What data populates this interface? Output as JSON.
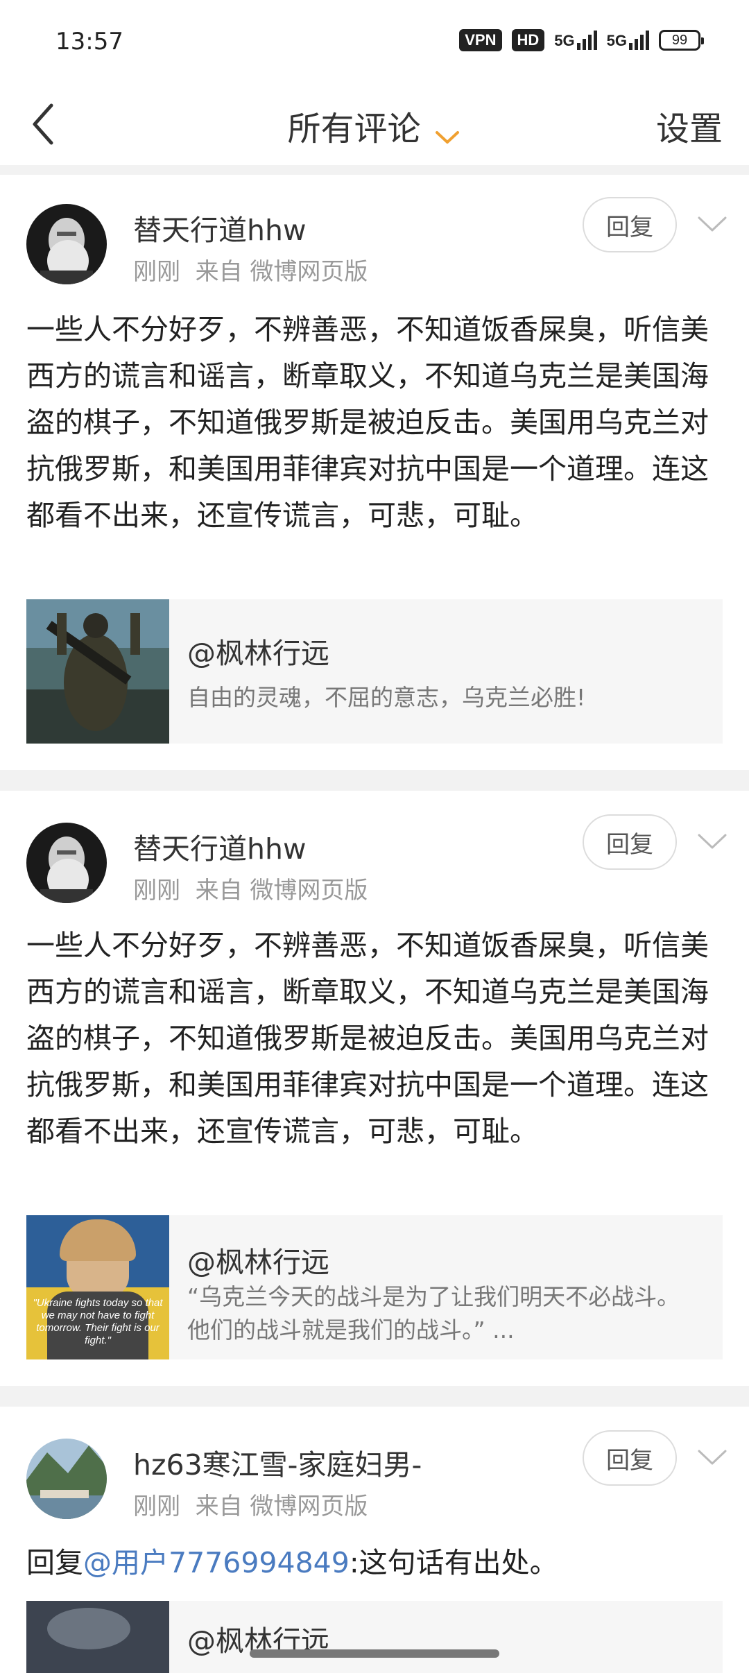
{
  "status_bar": {
    "time": "13:57",
    "vpn": "VPN",
    "hd": "HD",
    "net1": "5G",
    "net2": "5G",
    "battery": "99"
  },
  "header": {
    "title": "所有评论",
    "settings": "设置"
  },
  "comments": [
    {
      "username": "替天行道hhw",
      "time": "刚刚",
      "source": "来自 微博网页版",
      "reply_label": "回复",
      "text": "一些人不分好歹，不辨善恶，不知道饭香屎臭，听信美西方的谎言和谣言，断章取义，不知道乌克兰是美国海盗的棋子，不知道俄罗斯是被迫反击。美国用乌克兰对抗俄罗斯，和美国用菲律宾对抗中国是一个道理。连这都看不出来，还宣传谎言，可悲，可耻。",
      "quote": {
        "title": "@枫林行远",
        "subtitle": "自由的灵魂，不屈的意志，乌克兰必胜!"
      }
    },
    {
      "username": "替天行道hhw",
      "time": "刚刚",
      "source": "来自 微博网页版",
      "reply_label": "回复",
      "text": "一些人不分好歹，不辨善恶，不知道饭香屎臭，听信美西方的谎言和谣言，断章取义，不知道乌克兰是美国海盗的棋子，不知道俄罗斯是被迫反击。美国用乌克兰对抗俄罗斯，和美国用菲律宾对抗中国是一个道理。连这都看不出来，还宣传谎言，可悲，可耻。",
      "quote": {
        "title": "@枫林行远",
        "subtitle": "“乌克兰今天的战斗是为了让我们明天不必战斗。他们的战斗就是我们的战斗。” ...",
        "image_caption": "\"Ukraine fights today so that we may not have to fight tomorrow. Their fight is our fight.\""
      }
    },
    {
      "username": "hz63寒江雪-家庭妇男-",
      "time": "刚刚",
      "source": "来自 微博网页版",
      "reply_label": "回复",
      "reply_prefix": "回复",
      "mention": "@用户7776994849",
      "reply_text": ":这句话有出处。",
      "quote": {
        "title": "@枫林行远"
      }
    }
  ]
}
